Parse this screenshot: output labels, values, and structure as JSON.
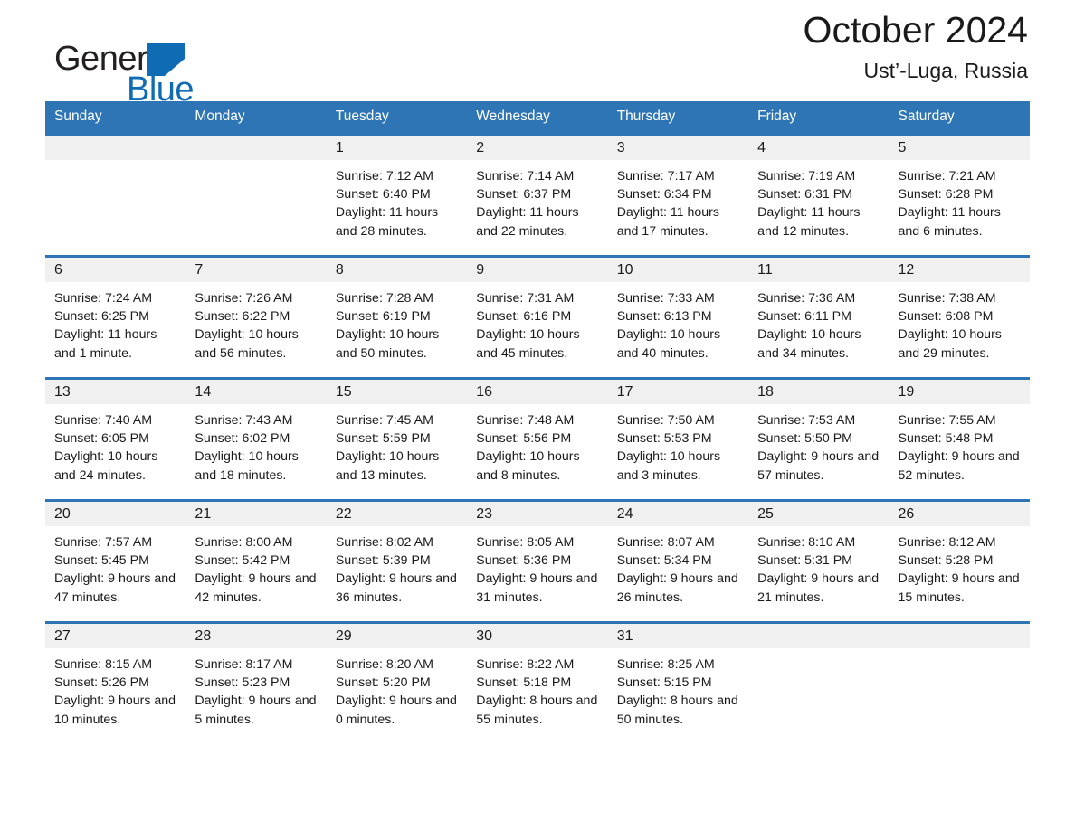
{
  "brand": {
    "name_part1": "General",
    "name_part2": "Blue",
    "flag_icon": "triangle-flag-icon",
    "accent_color": "#0f6cb4"
  },
  "header": {
    "title": "October 2024",
    "subtitle": "Ust’-Luga, Russia"
  },
  "theme": {
    "header_blue": "#2e75b6",
    "daynum_band": "#f0f0f0",
    "text": "#1a1a1a"
  },
  "calendar": {
    "weekday_headers": [
      "Sunday",
      "Monday",
      "Tuesday",
      "Wednesday",
      "Thursday",
      "Friday",
      "Saturday"
    ],
    "weeks": [
      [
        {
          "day": "",
          "sunrise": "",
          "sunset": "",
          "daylight": ""
        },
        {
          "day": "",
          "sunrise": "",
          "sunset": "",
          "daylight": ""
        },
        {
          "day": "1",
          "sunrise": "Sunrise: 7:12 AM",
          "sunset": "Sunset: 6:40 PM",
          "daylight": "Daylight: 11 hours and 28 minutes."
        },
        {
          "day": "2",
          "sunrise": "Sunrise: 7:14 AM",
          "sunset": "Sunset: 6:37 PM",
          "daylight": "Daylight: 11 hours and 22 minutes."
        },
        {
          "day": "3",
          "sunrise": "Sunrise: 7:17 AM",
          "sunset": "Sunset: 6:34 PM",
          "daylight": "Daylight: 11 hours and 17 minutes."
        },
        {
          "day": "4",
          "sunrise": "Sunrise: 7:19 AM",
          "sunset": "Sunset: 6:31 PM",
          "daylight": "Daylight: 11 hours and 12 minutes."
        },
        {
          "day": "5",
          "sunrise": "Sunrise: 7:21 AM",
          "sunset": "Sunset: 6:28 PM",
          "daylight": "Daylight: 11 hours and 6 minutes."
        }
      ],
      [
        {
          "day": "6",
          "sunrise": "Sunrise: 7:24 AM",
          "sunset": "Sunset: 6:25 PM",
          "daylight": "Daylight: 11 hours and 1 minute."
        },
        {
          "day": "7",
          "sunrise": "Sunrise: 7:26 AM",
          "sunset": "Sunset: 6:22 PM",
          "daylight": "Daylight: 10 hours and 56 minutes."
        },
        {
          "day": "8",
          "sunrise": "Sunrise: 7:28 AM",
          "sunset": "Sunset: 6:19 PM",
          "daylight": "Daylight: 10 hours and 50 minutes."
        },
        {
          "day": "9",
          "sunrise": "Sunrise: 7:31 AM",
          "sunset": "Sunset: 6:16 PM",
          "daylight": "Daylight: 10 hours and 45 minutes."
        },
        {
          "day": "10",
          "sunrise": "Sunrise: 7:33 AM",
          "sunset": "Sunset: 6:13 PM",
          "daylight": "Daylight: 10 hours and 40 minutes."
        },
        {
          "day": "11",
          "sunrise": "Sunrise: 7:36 AM",
          "sunset": "Sunset: 6:11 PM",
          "daylight": "Daylight: 10 hours and 34 minutes."
        },
        {
          "day": "12",
          "sunrise": "Sunrise: 7:38 AM",
          "sunset": "Sunset: 6:08 PM",
          "daylight": "Daylight: 10 hours and 29 minutes."
        }
      ],
      [
        {
          "day": "13",
          "sunrise": "Sunrise: 7:40 AM",
          "sunset": "Sunset: 6:05 PM",
          "daylight": "Daylight: 10 hours and 24 minutes."
        },
        {
          "day": "14",
          "sunrise": "Sunrise: 7:43 AM",
          "sunset": "Sunset: 6:02 PM",
          "daylight": "Daylight: 10 hours and 18 minutes."
        },
        {
          "day": "15",
          "sunrise": "Sunrise: 7:45 AM",
          "sunset": "Sunset: 5:59 PM",
          "daylight": "Daylight: 10 hours and 13 minutes."
        },
        {
          "day": "16",
          "sunrise": "Sunrise: 7:48 AM",
          "sunset": "Sunset: 5:56 PM",
          "daylight": "Daylight: 10 hours and 8 minutes."
        },
        {
          "day": "17",
          "sunrise": "Sunrise: 7:50 AM",
          "sunset": "Sunset: 5:53 PM",
          "daylight": "Daylight: 10 hours and 3 minutes."
        },
        {
          "day": "18",
          "sunrise": "Sunrise: 7:53 AM",
          "sunset": "Sunset: 5:50 PM",
          "daylight": "Daylight: 9 hours and 57 minutes."
        },
        {
          "day": "19",
          "sunrise": "Sunrise: 7:55 AM",
          "sunset": "Sunset: 5:48 PM",
          "daylight": "Daylight: 9 hours and 52 minutes."
        }
      ],
      [
        {
          "day": "20",
          "sunrise": "Sunrise: 7:57 AM",
          "sunset": "Sunset: 5:45 PM",
          "daylight": "Daylight: 9 hours and 47 minutes."
        },
        {
          "day": "21",
          "sunrise": "Sunrise: 8:00 AM",
          "sunset": "Sunset: 5:42 PM",
          "daylight": "Daylight: 9 hours and 42 minutes."
        },
        {
          "day": "22",
          "sunrise": "Sunrise: 8:02 AM",
          "sunset": "Sunset: 5:39 PM",
          "daylight": "Daylight: 9 hours and 36 minutes."
        },
        {
          "day": "23",
          "sunrise": "Sunrise: 8:05 AM",
          "sunset": "Sunset: 5:36 PM",
          "daylight": "Daylight: 9 hours and 31 minutes."
        },
        {
          "day": "24",
          "sunrise": "Sunrise: 8:07 AM",
          "sunset": "Sunset: 5:34 PM",
          "daylight": "Daylight: 9 hours and 26 minutes."
        },
        {
          "day": "25",
          "sunrise": "Sunrise: 8:10 AM",
          "sunset": "Sunset: 5:31 PM",
          "daylight": "Daylight: 9 hours and 21 minutes."
        },
        {
          "day": "26",
          "sunrise": "Sunrise: 8:12 AM",
          "sunset": "Sunset: 5:28 PM",
          "daylight": "Daylight: 9 hours and 15 minutes."
        }
      ],
      [
        {
          "day": "27",
          "sunrise": "Sunrise: 8:15 AM",
          "sunset": "Sunset: 5:26 PM",
          "daylight": "Daylight: 9 hours and 10 minutes."
        },
        {
          "day": "28",
          "sunrise": "Sunrise: 8:17 AM",
          "sunset": "Sunset: 5:23 PM",
          "daylight": "Daylight: 9 hours and 5 minutes."
        },
        {
          "day": "29",
          "sunrise": "Sunrise: 8:20 AM",
          "sunset": "Sunset: 5:20 PM",
          "daylight": "Daylight: 9 hours and 0 minutes."
        },
        {
          "day": "30",
          "sunrise": "Sunrise: 8:22 AM",
          "sunset": "Sunset: 5:18 PM",
          "daylight": "Daylight: 8 hours and 55 minutes."
        },
        {
          "day": "31",
          "sunrise": "Sunrise: 8:25 AM",
          "sunset": "Sunset: 5:15 PM",
          "daylight": "Daylight: 8 hours and 50 minutes."
        },
        {
          "day": "",
          "sunrise": "",
          "sunset": "",
          "daylight": ""
        },
        {
          "day": "",
          "sunrise": "",
          "sunset": "",
          "daylight": ""
        }
      ]
    ]
  }
}
